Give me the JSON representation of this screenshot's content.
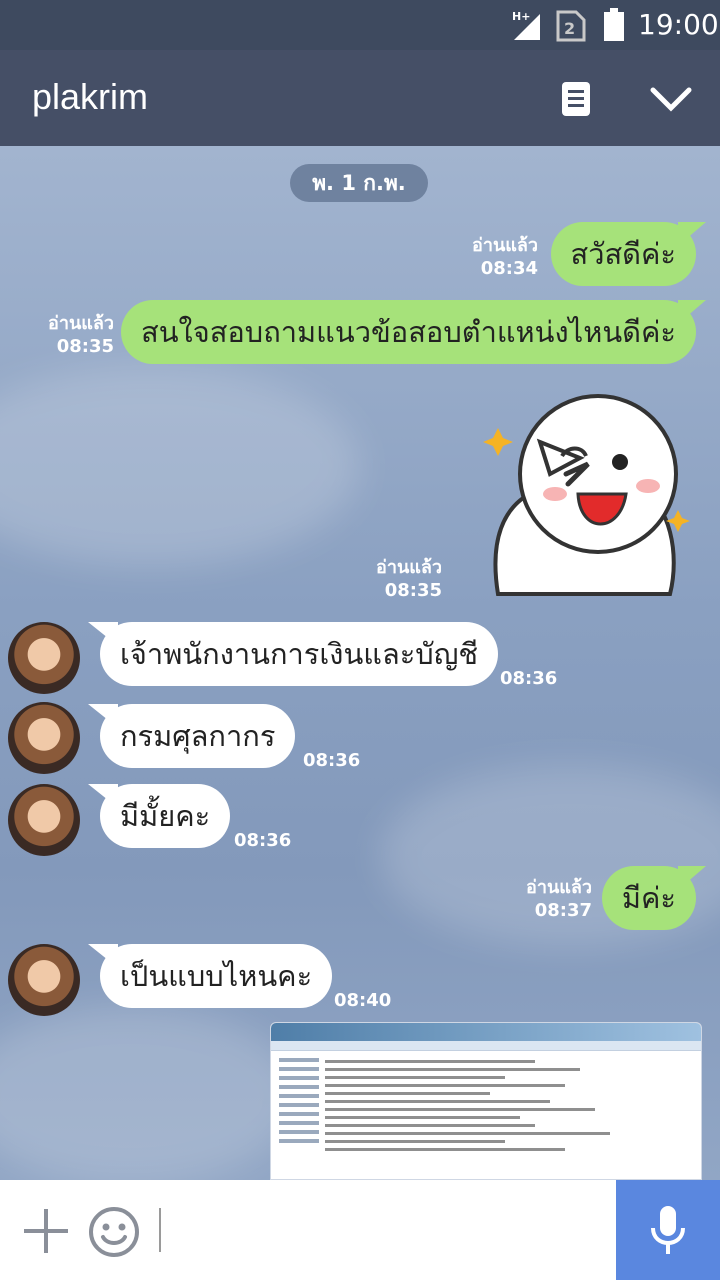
{
  "status_bar": {
    "network": "H+",
    "sim": "2",
    "time": "19:00"
  },
  "header": {
    "title": "plakrim"
  },
  "date_divider": "พ. 1 ก.พ.",
  "messages": [
    {
      "dir": "out",
      "text": "สวัสดีค่ะ",
      "read": "อ่านแล้ว",
      "time": "08:34"
    },
    {
      "dir": "out",
      "text": "สนใจสอบถามแนวข้อสอบตำแหน่งไหนดีค่ะ",
      "read": "อ่านแล้ว",
      "time": "08:35"
    },
    {
      "dir": "out",
      "type": "sticker",
      "read": "อ่านแล้ว",
      "time": "08:35"
    },
    {
      "dir": "in",
      "text": "เจ้าพนักงานการเงินและบัญชี",
      "time": "08:36"
    },
    {
      "dir": "in",
      "text": "กรมศุลกากร",
      "time": "08:36"
    },
    {
      "dir": "in",
      "text": "มีมั้ยคะ",
      "time": "08:36"
    },
    {
      "dir": "out",
      "text": "มีค่ะ",
      "read": "อ่านแล้ว",
      "time": "08:37"
    },
    {
      "dir": "in",
      "text": "เป็นแบบไหนคะ",
      "time": "08:40"
    },
    {
      "dir": "out",
      "type": "image"
    }
  ],
  "input": {
    "placeholder": "",
    "value": ""
  },
  "colors": {
    "header": "#454f66",
    "status_bar": "#3e4a5f",
    "bubble_out": "#a6e27a",
    "bubble_in": "#ffffff",
    "mic": "#5a87df"
  },
  "icons": [
    "network-signal-icon",
    "sim-icon",
    "battery-icon",
    "notes-icon",
    "chevron-down-icon",
    "plus-icon",
    "emoji-icon",
    "microphone-icon"
  ]
}
